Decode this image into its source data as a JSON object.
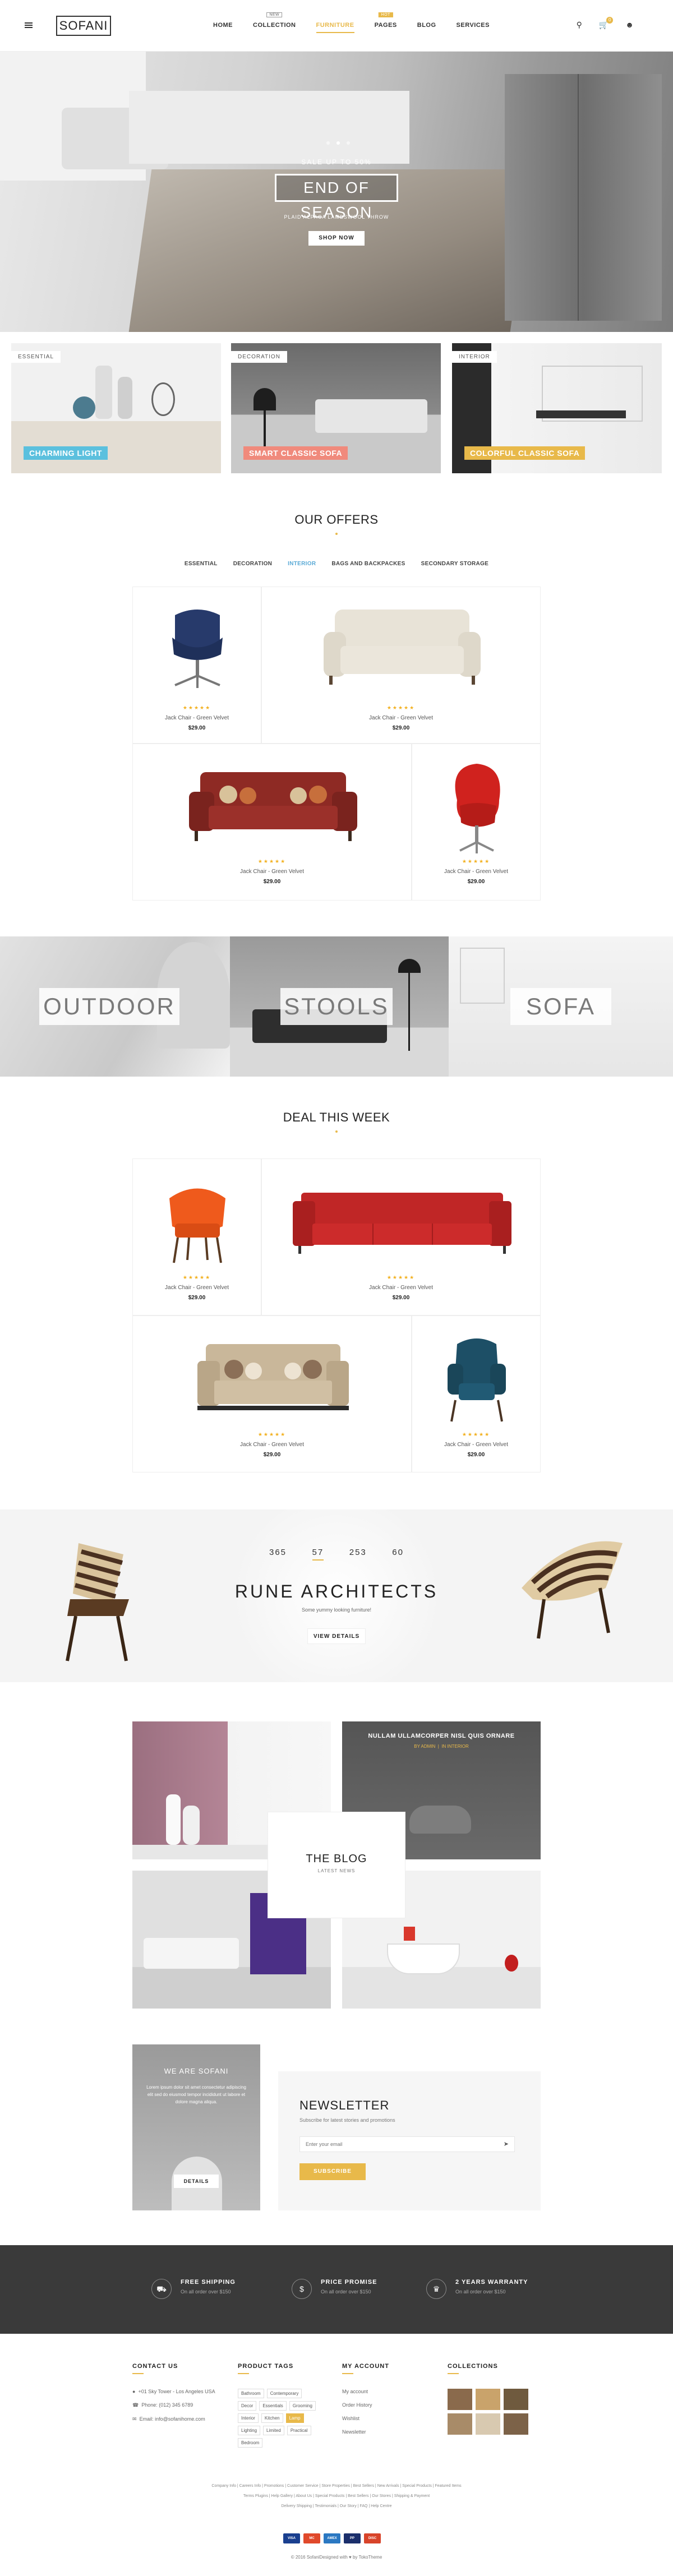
{
  "header": {
    "logo": "SOFANI",
    "nav": [
      {
        "label": "HOME",
        "badge": ""
      },
      {
        "label": "COLLECTION",
        "badge": "NEW"
      },
      {
        "label": "FURNITURE",
        "badge": ""
      },
      {
        "label": "PAGES",
        "badge": "HOT"
      },
      {
        "label": "BLOG",
        "badge": ""
      },
      {
        "label": "SERVICES",
        "badge": ""
      }
    ],
    "cart_count": "0"
  },
  "hero": {
    "subtitle": "SALE UP TO 50%",
    "title": "END OF SEASON",
    "caption": "PLAID ALPACA LAMBSWOOL THROW",
    "button": "SHOP NOW"
  },
  "banners": [
    {
      "tag": "ESSENTIAL",
      "caption": "CHARMING LIGHT",
      "color": "#5bc0de"
    },
    {
      "tag": "DECORATION",
      "caption": "SMART CLASSIC SOFA",
      "color": "#f08a7c"
    },
    {
      "tag": "INTERIOR",
      "caption": "COLORFUL CLASSIC SOFA",
      "color": "#e8b94a"
    }
  ],
  "offers": {
    "title": "OUR OFFERS",
    "tabs": [
      "ESSENTIAL",
      "DECORATION",
      "INTERIOR",
      "BAGS AND BACKPACKES",
      "SECONDARY STORAGE"
    ],
    "active_tab": "INTERIOR",
    "products": [
      {
        "name": "Jack Chair - Green Velvet",
        "price": "$29.00",
        "stars": "★★★★★"
      },
      {
        "name": "Jack Chair - Green Velvet",
        "price": "$29.00",
        "stars": "★★★★★"
      },
      {
        "name": "Jack Chair - Green Velvet",
        "price": "$29.00",
        "stars": "★★★★★"
      },
      {
        "name": "Jack Chair - Green Velvet",
        "price": "$29.00",
        "stars": "★★★★★"
      }
    ]
  },
  "categories": [
    "OUTDOOR",
    "STOOLS",
    "SOFA"
  ],
  "deal": {
    "title": "DEAL THIS WEEK",
    "products": [
      {
        "name": "Jack Chair - Green Velvet",
        "price": "$29.00",
        "stars": "★★★★★"
      },
      {
        "name": "Jack Chair - Green Velvet",
        "price": "$29.00",
        "stars": "★★★★★"
      },
      {
        "name": "Jack Chair - Green Velvet",
        "price": "$29.00",
        "stars": "★★★★★"
      },
      {
        "name": "Jack Chair - Green Velvet",
        "price": "$29.00",
        "stars": "★★★★★"
      }
    ]
  },
  "architects": {
    "countdown": [
      "365",
      "57",
      "253",
      "60"
    ],
    "title": "RUNE ARCHITECTS",
    "subtitle": "Some yummy looking furniture!",
    "button": "VIEW DETAILS"
  },
  "blog": {
    "title": "THE BLOG",
    "subtitle": "LATEST NEWS",
    "post_title": "NULLAM ULLAMCORPER NISL QUIS ORNARE",
    "post_meta_1": "BY ADMIN",
    "post_meta_2": "IN INTERIOR"
  },
  "about": {
    "title": "WE ARE SOFANI",
    "text": "Lorem ipsum dolor sit amet consectetur adipiscing elit sed do eiusmod tempor incididunt ut labore et dolore magna aliqua.",
    "button": "DETAILS"
  },
  "newsletter": {
    "title": "NEWSLETTER",
    "subtitle": "Subscribe for latest stories and promotions",
    "placeholder": "Enter your email",
    "button": "SUBSCRIBE"
  },
  "features": [
    {
      "icon": "truck-icon",
      "title": "FREE SHIPPING",
      "sub": "On all order over $150"
    },
    {
      "icon": "dollar-icon",
      "title": "PRICE PROMISE",
      "sub": "On all order over $150"
    },
    {
      "icon": "trophy-icon",
      "title": "2 YEARS WARRANTY",
      "sub": "On all order over $150"
    }
  ],
  "footer": {
    "contact_title": "CONTACT US",
    "contact": [
      "+01 Sky Tower - Los Angeles USA",
      "Phone: (012) 345 6789",
      "Email: info@sofanihome.com"
    ],
    "tags_title": "PRODUCT TAGS",
    "tags": [
      "Bathroom",
      "Contemporary",
      "Decor",
      "Essentials",
      "Grooming",
      "Interior",
      "Kitchen",
      "Lamp",
      "Lighting",
      "Limited",
      "Practical",
      "Bedroom"
    ],
    "active_tag": "Lamp",
    "account_title": "MY ACCOUNT",
    "account": [
      "My account",
      "Order History",
      "Wishlist",
      "Newsletter"
    ],
    "collections_title": "COLLECTIONS",
    "links_1": "Company Info  |  Careers Info  |  Promotions  |  Customer Service  |  Store Properties  |  Best Sellers  |  New Arrivals  |  Special Products  |  Featured Items",
    "links_2": "Terms Plugins  |  Help Gallery  |  About Us  |  Special Products  |  Best Sellers  |  Our Stores  |  Shipping & Payment",
    "links_3": "Delivery Shipping  |  Testimonials  |  Our Story  |  FAQ  |  Help Centre",
    "copyright": "© 2016 SofaniDesigned with ♥ by TokoTheme"
  },
  "colors": {
    "accent": "#e8b94a",
    "tab_active": "#5aaad6",
    "dark": "#3a3a3a"
  }
}
